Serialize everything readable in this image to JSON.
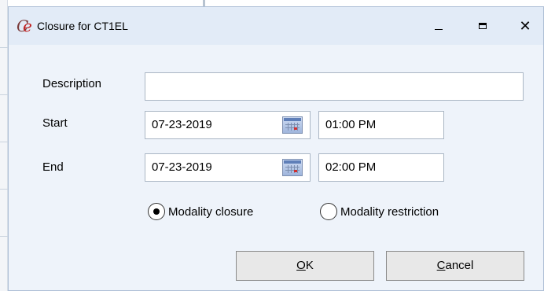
{
  "dialog": {
    "title": "Closure for CT1EL",
    "window_controls": {
      "minimize_icon": "minimize-icon",
      "maximize_icon": "maximize-icon",
      "close_icon": "close-icon"
    }
  },
  "form": {
    "description": {
      "label": "Description",
      "value": ""
    },
    "start": {
      "label": "Start",
      "date": "07-23-2019",
      "time": "01:00 PM"
    },
    "end": {
      "label": "End",
      "date": "07-23-2019",
      "time": "02:00 PM"
    },
    "closure_type": {
      "options": [
        {
          "label": "Modality closure",
          "selected": true
        },
        {
          "label": "Modality restriction",
          "selected": false
        }
      ]
    }
  },
  "buttons": {
    "ok": {
      "mnemonic": "O",
      "rest": "K"
    },
    "cancel": {
      "mnemonic": "C",
      "rest": "ancel"
    }
  },
  "colors": {
    "titlebar": "#e2ebf7",
    "dialog_bg": "#eef3fa",
    "button_bg": "#e8e8e8"
  }
}
